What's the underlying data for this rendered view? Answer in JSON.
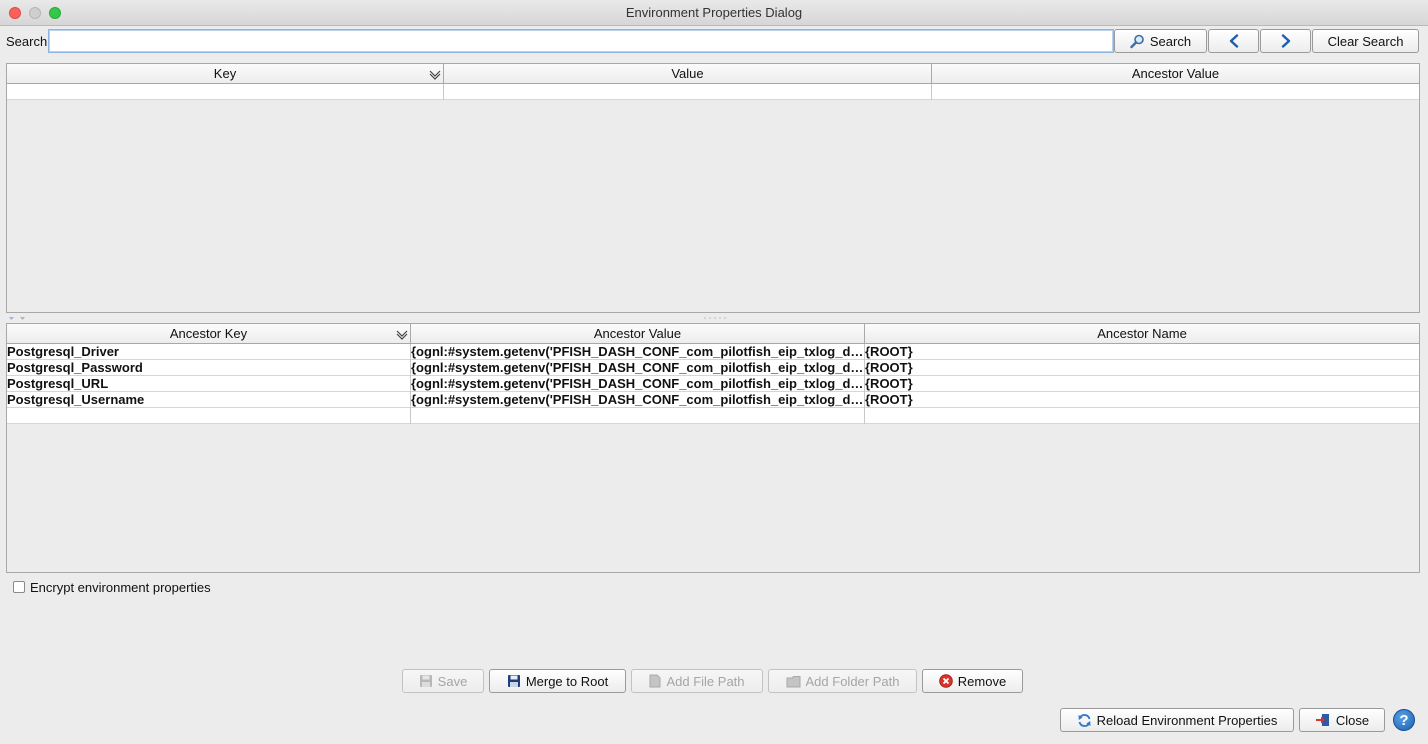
{
  "window": {
    "title": "Environment Properties Dialog"
  },
  "search": {
    "label": "Search:",
    "value": "",
    "placeholder": "",
    "search_label": "Search",
    "clear_label": "Clear Search"
  },
  "top_table": {
    "columns": [
      "Key",
      "Value",
      "Ancestor Value"
    ],
    "rows": [
      [
        "",
        "",
        ""
      ]
    ]
  },
  "ancestor_table": {
    "columns": [
      "Ancestor Key",
      "Ancestor Value",
      "Ancestor Name"
    ],
    "rows": [
      [
        "Postgresql_Driver",
        "{ognl:#system.getenv('PFISH_DASH_CONF_com_pilotfish_eip_txlog_dbD...",
        "{ROOT}"
      ],
      [
        "Postgresql_Password",
        "{ognl:#system.getenv('PFISH_DASH_CONF_com_pilotfish_eip_txlog_dbP...",
        "{ROOT}"
      ],
      [
        "Postgresql_URL",
        "{ognl:#system.getenv('PFISH_DASH_CONF_com_pilotfish_eip_txlog_dbU...",
        "{ROOT}"
      ],
      [
        "Postgresql_Username",
        "{ognl:#system.getenv('PFISH_DASH_CONF_com_pilotfish_eip_txlog_dbU...",
        "{ROOT}"
      ],
      [
        "",
        "",
        ""
      ]
    ]
  },
  "options": {
    "encrypt_label": "Encrypt environment properties",
    "encrypt_checked": false
  },
  "actions": {
    "save": "Save",
    "merge": "Merge to Root",
    "add_file": "Add File Path",
    "add_folder": "Add Folder Path",
    "remove": "Remove"
  },
  "footer": {
    "reload": "Reload Environment Properties",
    "close": "Close",
    "help": "?"
  },
  "colors": {
    "accent": "#1c5fb0",
    "remove_red": "#d9342b",
    "selection_border": "#8fb5de"
  }
}
